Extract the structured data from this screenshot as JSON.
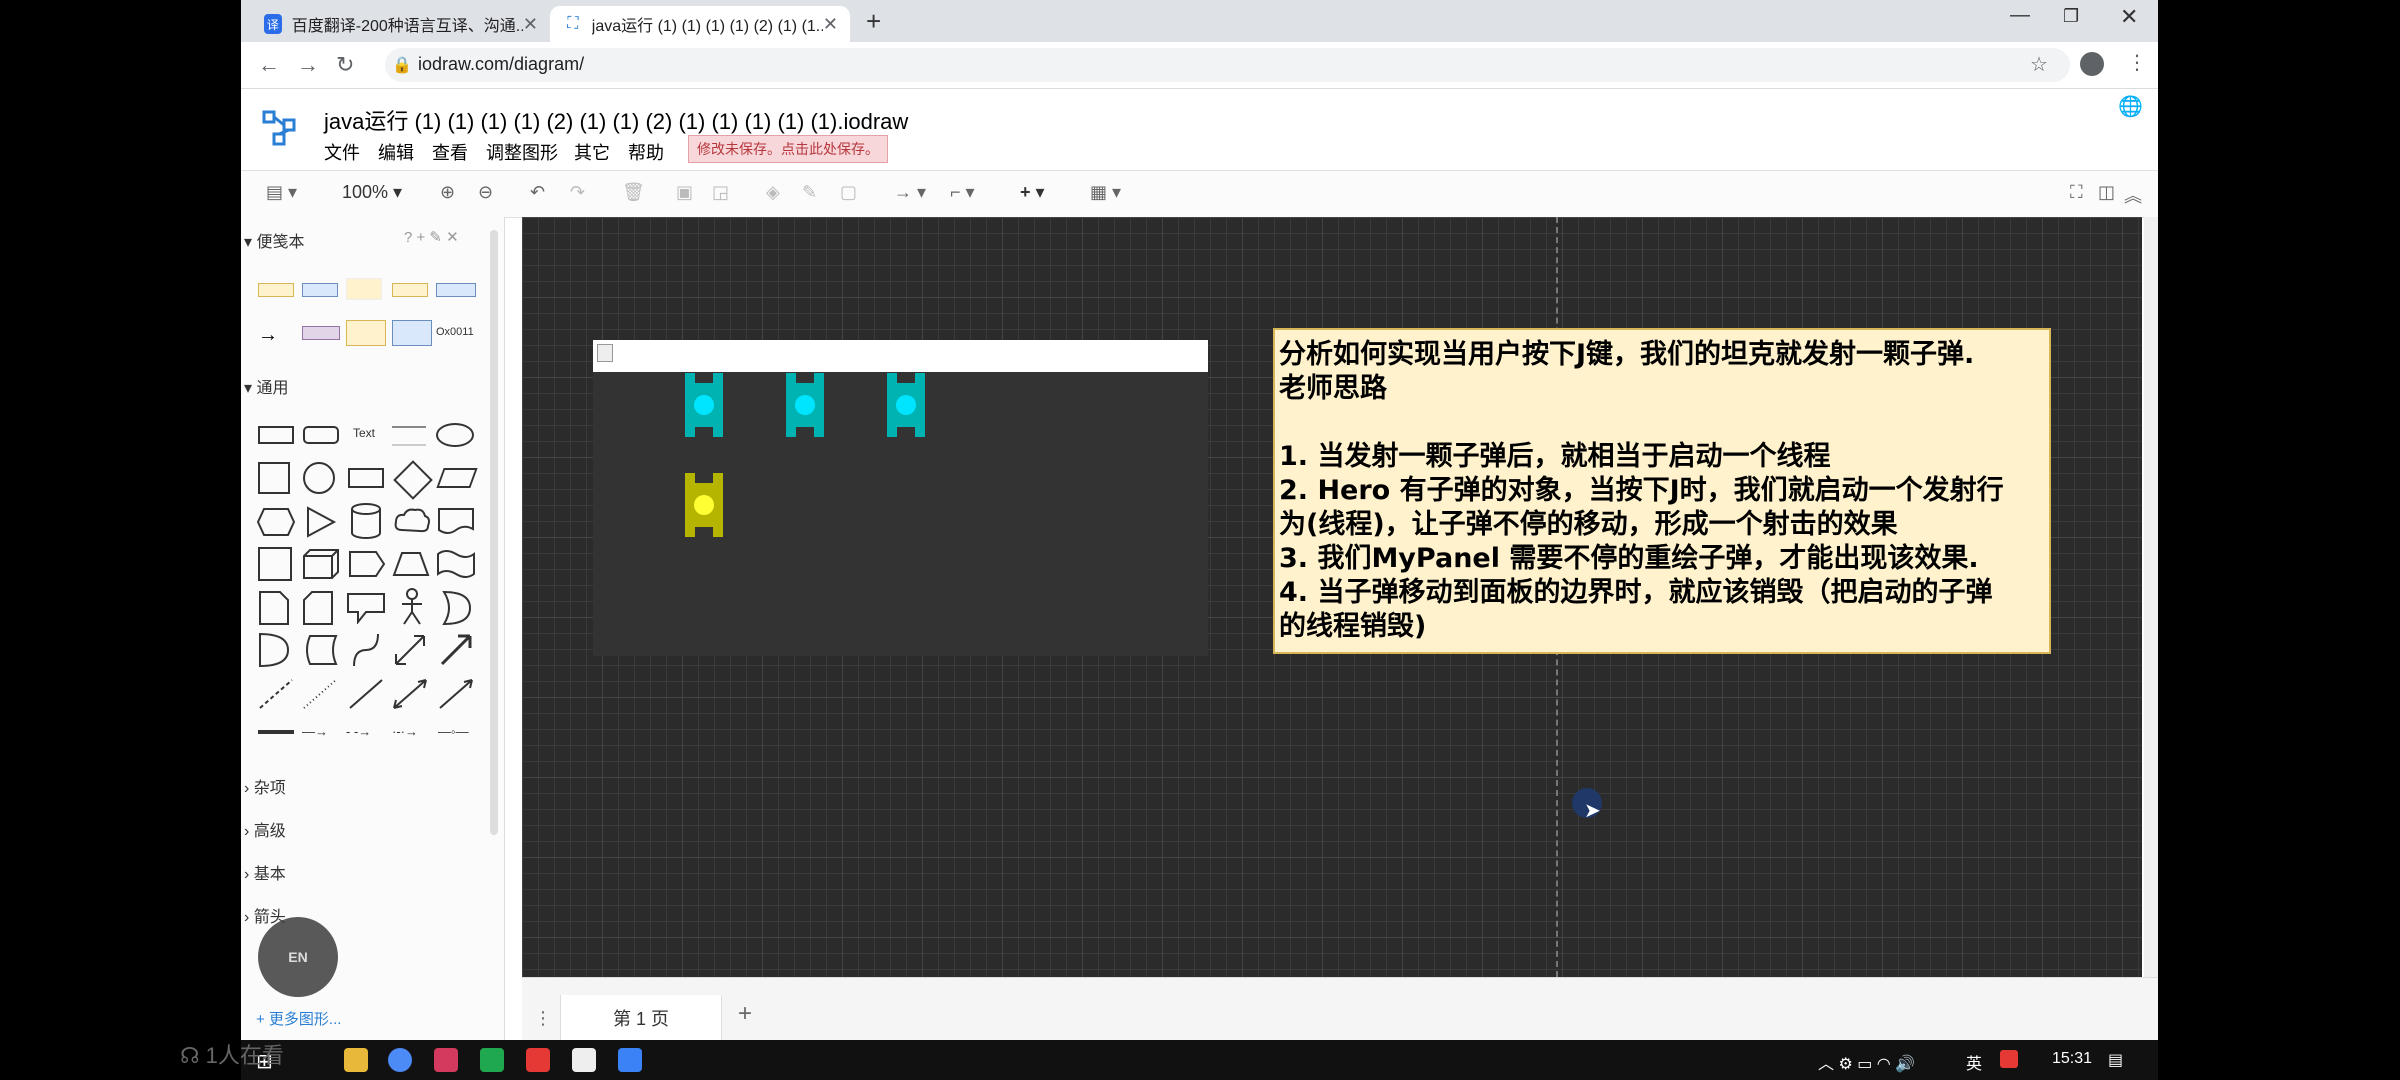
{
  "browser": {
    "tabs": [
      {
        "title": "百度翻译-200种语言互译、沟通...",
        "favicon": "baidu-translate"
      },
      {
        "title": "java运行 (1) (1) (1) (1) (2) (1) (1...",
        "favicon": "iodraw"
      }
    ],
    "url": "iodraw.com/diagram/"
  },
  "app": {
    "doc_title": "java运行 (1) (1) (1) (1) (2) (1) (1) (2) (1) (1) (1) (1) (1).iodraw",
    "menu": [
      "文件",
      "编辑",
      "查看",
      "调整图形",
      "其它",
      "帮助"
    ],
    "unsaved_notice": "修改未保存。点击此处保存。",
    "zoom": "100%"
  },
  "sidebar": {
    "scratchpad_label": "便笺本",
    "general_label": "通用",
    "shape_text_label": "Text",
    "scratch_hex_label": "Ox0011",
    "collapsed_sections": [
      "杂项",
      "高级",
      "基本",
      "箭头"
    ],
    "more_shapes": "+ 更多图形..."
  },
  "note": {
    "lines": [
      "分析如何实现当用户按下J键，我们的坦克就发射一颗子弹.",
      "老师思路",
      "",
      "1. 当发射一颗子弹后，就相当于启动一个线程",
      "2. Hero 有子弹的对象，当按下J时，我们就启动一个发射行",
      "为(线程)，让子弹不停的移动，形成一个射击的效果",
      "3. 我们MyPanel 需要不停的重绘子弹，才能出现该效果.",
      "4. 当子弹移动到面板的边界时，就应该销毁（把启动的子弹",
      "的线程销毁)"
    ]
  },
  "tanks": {
    "enemy_color": "#00b3b3",
    "hero_color": "#c8c800",
    "enemy_count": 3
  },
  "bottom": {
    "page_tab": "第 1 页",
    "add_page": "+"
  },
  "taskbar": {
    "clock": "15:31",
    "ime": "英",
    "ime_bubble": "EN"
  },
  "overlay": {
    "viewers": "1人在看"
  }
}
